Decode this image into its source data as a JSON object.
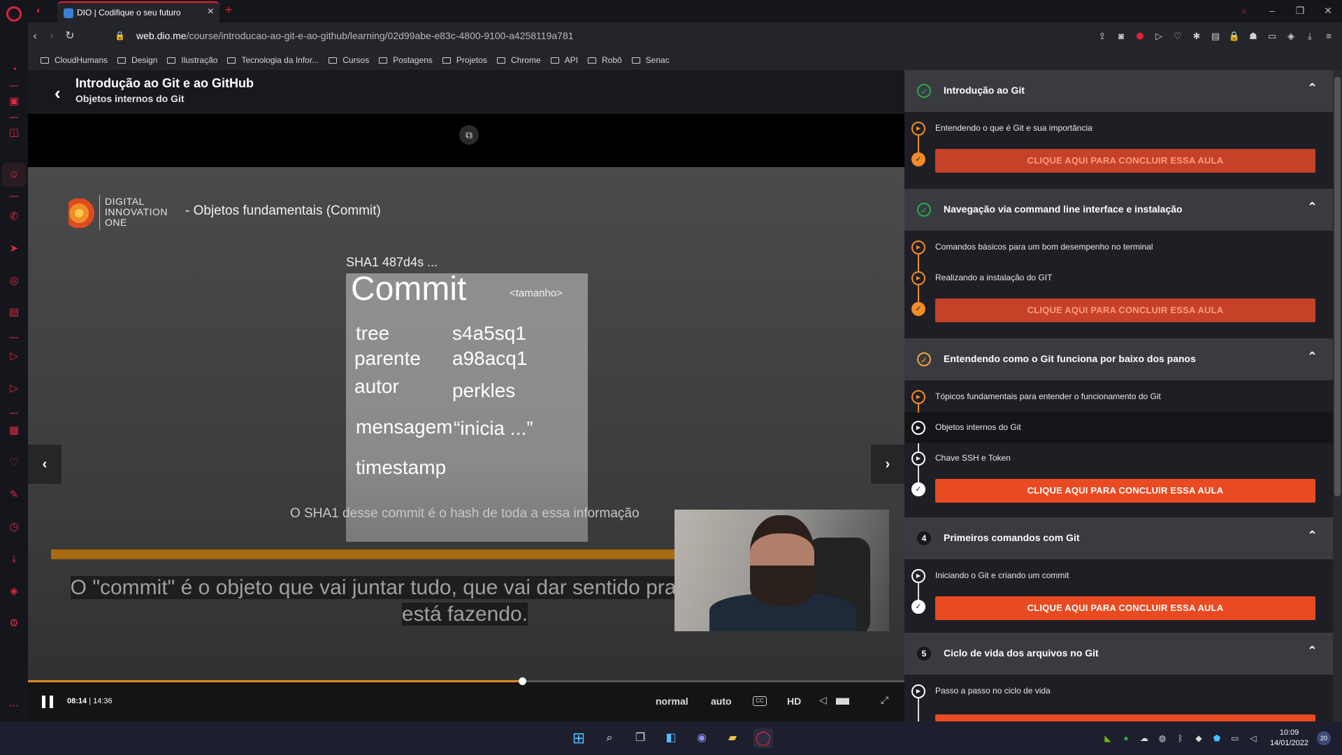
{
  "browser": {
    "tab_title": "DIO | Codifique o seu futuro",
    "url_domain": "web.dio.me",
    "url_path": "/course/introducao-ao-git-e-ao-github/learning/02d99abe-e83c-4800-9100-a4258119a781",
    "bookmarks": [
      "CloudHumans",
      "Design",
      "Ilustração",
      "Tecnologia da Infor...",
      "Cursos",
      "Postagens",
      "Projetos",
      "Chrome",
      "API",
      "Robô",
      "Senac"
    ],
    "sidebar_badge": "1"
  },
  "course": {
    "title": "Introdução ao Git e ao GitHub",
    "current_lesson": "Objetos internos do Git"
  },
  "slide": {
    "brand_lines": [
      "DIGITAL",
      "INNOVATION",
      "ONE"
    ],
    "title": "- Objetos fundamentais (Commit)",
    "sha_label": "SHA1 487d4s ...",
    "card_title": "Commit",
    "card_size": "<tamanho>",
    "fields": [
      {
        "key": "tree",
        "value": "s4a5sq1"
      },
      {
        "key": "parente",
        "value": "a98acq1"
      },
      {
        "key": "autor",
        "value": "perkles"
      },
      {
        "key": "mensagem",
        "value": "“inicia ...”"
      },
      {
        "key": "timestamp",
        "value": ""
      }
    ],
    "caption": "O SHA1 desse commit é o hash de toda a essa informação"
  },
  "subtitle": {
    "line1": "O \"commit\" é o objeto que vai juntar tudo, que vai dar sentido pra alteração que você",
    "line2": "está fazendo."
  },
  "player": {
    "current_time": "08:14",
    "separator": "|",
    "duration": "14:36",
    "progress": 0.564,
    "speed": "normal",
    "quality_mode": "auto",
    "cc": "CC",
    "hd": "HD",
    "volume_bars": "IIIIIIIIII"
  },
  "panel": {
    "cta_label": "CLIQUE AQUI PARA CONCLUIR ESSA AULA",
    "sections": [
      {
        "title": "Introdução ao Git",
        "status": "done",
        "lessons": [
          "Entendendo o que é Git e sua importância"
        ]
      },
      {
        "title": "Navegação via command line interface e instalação",
        "status": "done",
        "lessons": [
          "Comandos básicos para um bom desempenho no terminal",
          "Realizando a instalação do GIT"
        ]
      },
      {
        "title": "Entendendo como o Git funciona por baixo dos panos",
        "status": "in-progress",
        "lessons": [
          "Tópicos fundamentais para entender o funcionamento do Git",
          "Objetos internos do Git",
          "Chave SSH e Token"
        ]
      },
      {
        "title": "Primeiros comandos com Git",
        "number": "4",
        "lessons": [
          "Iniciando o Git e criando um commit"
        ]
      },
      {
        "title": "Ciclo de vida dos arquivos no Git",
        "number": "5",
        "lessons": [
          "Passo a passo no ciclo de vida"
        ]
      }
    ]
  },
  "taskbar": {
    "time": "10:09",
    "date": "14/01/2022",
    "notifications": "20"
  },
  "colors": {
    "opera_red": "#e0223a",
    "dio_orange": "#f28c28",
    "cta_red": "#ea4a21",
    "done_green": "#2fa84f"
  }
}
